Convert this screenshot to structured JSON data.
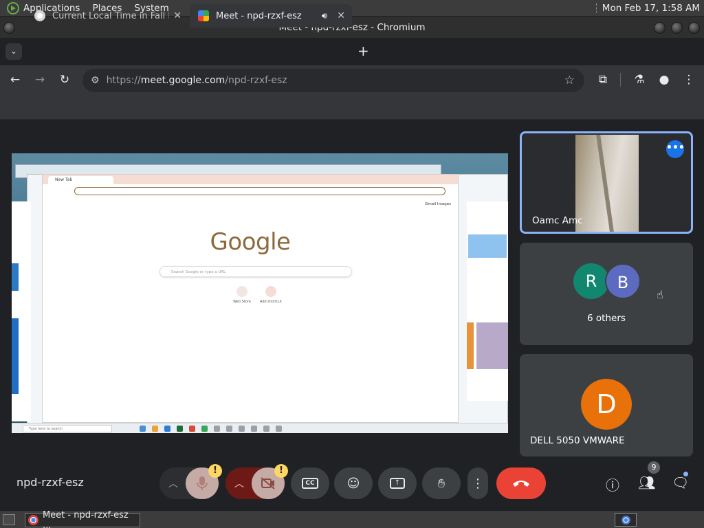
{
  "system_panel": {
    "menus": [
      "Applications",
      "Places",
      "System"
    ],
    "clock": "Mon Feb 17,  1:58 AM"
  },
  "window": {
    "title": "Meet - npd-rzxf-esz - Chromium"
  },
  "tabs": [
    {
      "title": "Current Local Time in Fall River",
      "active": false
    },
    {
      "title": "Meet - npd-rzxf-esz",
      "active": true
    }
  ],
  "address_bar": {
    "scheme": "https://",
    "host": "meet.google.com",
    "path": "/npd-rzxf-esz"
  },
  "presentation": {
    "inner_tab": "New Tab",
    "inner_links": "Gmail   Images",
    "google_logo": "Google",
    "search_placeholder": "Search Google or type a URL",
    "shortcuts": [
      "Web Store",
      "Add shortcut"
    ],
    "taskbar_search": "Type here to search"
  },
  "participants": [
    {
      "name": "Oamc Amc",
      "has_video": true
    },
    {
      "initials": [
        "R",
        "B"
      ],
      "label": "6 others"
    },
    {
      "initial": "D",
      "name": "DELL 5050 VMWARE",
      "color": "#e8710a"
    }
  ],
  "controls": {
    "meeting_code": "npd-rzxf-esz",
    "participant_count": "9",
    "warning_glyph": "!"
  },
  "os_taskbar": {
    "task_label": "Meet - npd-rzxf-esz ..."
  },
  "colors": {
    "accent": "#8ab4f8",
    "end_call": "#ea4335",
    "warning": "#fdd663"
  }
}
